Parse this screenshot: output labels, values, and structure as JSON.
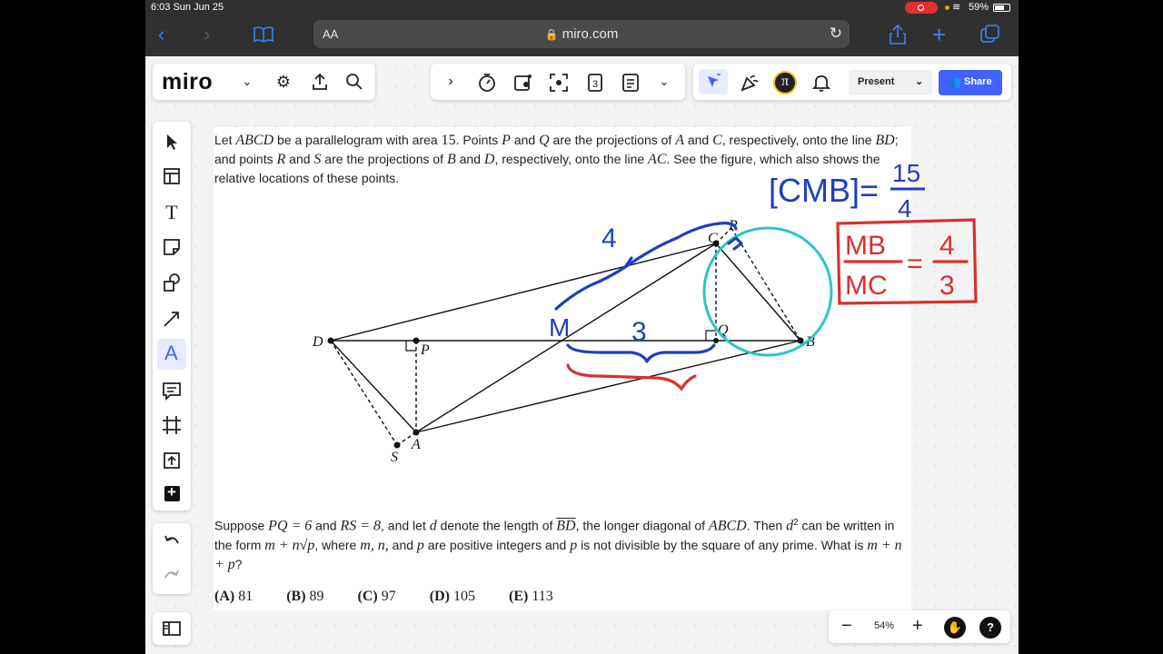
{
  "status_bar": {
    "time_date": "6:03   Sun Jun 25",
    "battery": "59%"
  },
  "browser": {
    "text_size": "AA",
    "url": "miro.com"
  },
  "miro": {
    "logo": "miro",
    "present_label": "Present",
    "share_label": "Share",
    "zoom_level": "54%",
    "help_label": "?"
  },
  "problem": {
    "intro_1": "Let ",
    "abcd": "ABCD",
    "intro_2": " be a parallelogram with area ",
    "area": "15",
    "intro_3": ". Points ",
    "P": "P",
    "and": " and ",
    "Q": "Q",
    "intro_4": " are the projections of ",
    "A": "A",
    "C": "C",
    "intro_5": ", respectively, onto the line ",
    "BD": "BD",
    "intro_6": "; and points ",
    "R": "R",
    "S": "S",
    "B": "B",
    "D": "D",
    "intro_7": ", respectively, onto the line ",
    "AC": "AC",
    "intro_8": ". See the figure, which also shows the relative locations of these points.",
    "q_1": "Suppose ",
    "PQ_eq": "PQ = 6",
    "q_2": " and ",
    "RS_eq": "RS = 8",
    "q_3": ", and let ",
    "d": "d",
    "q_4": " denote the length of ",
    "BD_bar": "BD",
    "q_5": ", the longer diagonal of ",
    "q_6": ". Then ",
    "d2": "d",
    "sup2": "2",
    "q_7": " can be written in the form ",
    "form": "m + n√p",
    "q_8": ", where ",
    "mn": "m, n,",
    "q_9": " and ",
    "p": "p",
    "q_10": " are positive integers and ",
    "q_11": " is not divisible by the square of any prime. What is ",
    "sum": "m + n + p",
    "q_12": "?",
    "choices": [
      {
        "letter": "(A)",
        "value": "81"
      },
      {
        "letter": "(B)",
        "value": "89"
      },
      {
        "letter": "(C)",
        "value": "97"
      },
      {
        "letter": "(D)",
        "value": "105"
      },
      {
        "letter": "(E)",
        "value": "113"
      }
    ]
  },
  "figure": {
    "labels": {
      "D": "D",
      "P": "P",
      "Q": "Q",
      "B": "B",
      "C": "C",
      "R": "R",
      "A": "A",
      "S": "S"
    }
  },
  "annotations": {
    "blue_4": "4",
    "blue_M": "M",
    "blue_3": "3",
    "cmb_eq": "[CMB]=",
    "cmb_num": "15",
    "cmb_den": "4",
    "red_num_left": "MB",
    "red_den_left": "MC",
    "red_eq": "=",
    "red_num_right": "4",
    "red_den_right": "3"
  },
  "colors": {
    "blue_ink": "#1f3fbf",
    "red_ink": "#d93030",
    "teal_ink": "#2ec4c4",
    "share_blue": "#4262ff"
  }
}
